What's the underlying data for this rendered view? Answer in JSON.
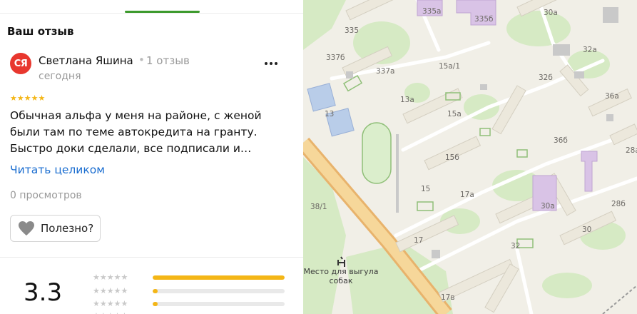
{
  "review_panel": {
    "section_title": "Ваш отзыв",
    "author": {
      "initials": "СЯ",
      "name": "Светлана Яшина",
      "separator": "•",
      "reviews_count": "1 отзыв",
      "date": "сегодня",
      "avatar_color": "#e8372e"
    },
    "rating_stars": "★★★★★",
    "review_rating": 5,
    "text_lines": [
      "Обычная альфа у меня на районе, с женой",
      "были там по теме автокредита на гранту.",
      "Быстро доки сделали, все подписали и…"
    ],
    "read_more": "Читать целиком",
    "views": "0 просмотров",
    "useful_label": "Полезно?"
  },
  "rating_summary": {
    "value": "3.3",
    "distribution": [
      {
        "stars": "★★★★★",
        "fraction": 1.0
      },
      {
        "stars": "★★★★★",
        "fraction": 0.04
      },
      {
        "stars": "★★★★★",
        "fraction": 0.04
      },
      {
        "stars": "★★★★★",
        "fraction": 0.04
      }
    ]
  },
  "map": {
    "labels": [
      "335а",
      "335б",
      "30а",
      "335",
      "32а",
      "337б",
      "337а",
      "15а/1",
      "32б",
      "13а",
      "36а",
      "13",
      "15а",
      "36б",
      "28а",
      "15б",
      "15",
      "17а",
      "30а",
      "38/1",
      "28б",
      "17",
      "30",
      "32",
      "17в"
    ],
    "poi": "Место для выгула собак",
    "poi_lines": [
      "Место для выгула",
      "собак"
    ]
  },
  "colors": {
    "accent_green": "#3c9a2c",
    "star_yellow": "#f4b616",
    "link_blue": "#1a6dd0",
    "road_orange": "#f2c27e"
  }
}
